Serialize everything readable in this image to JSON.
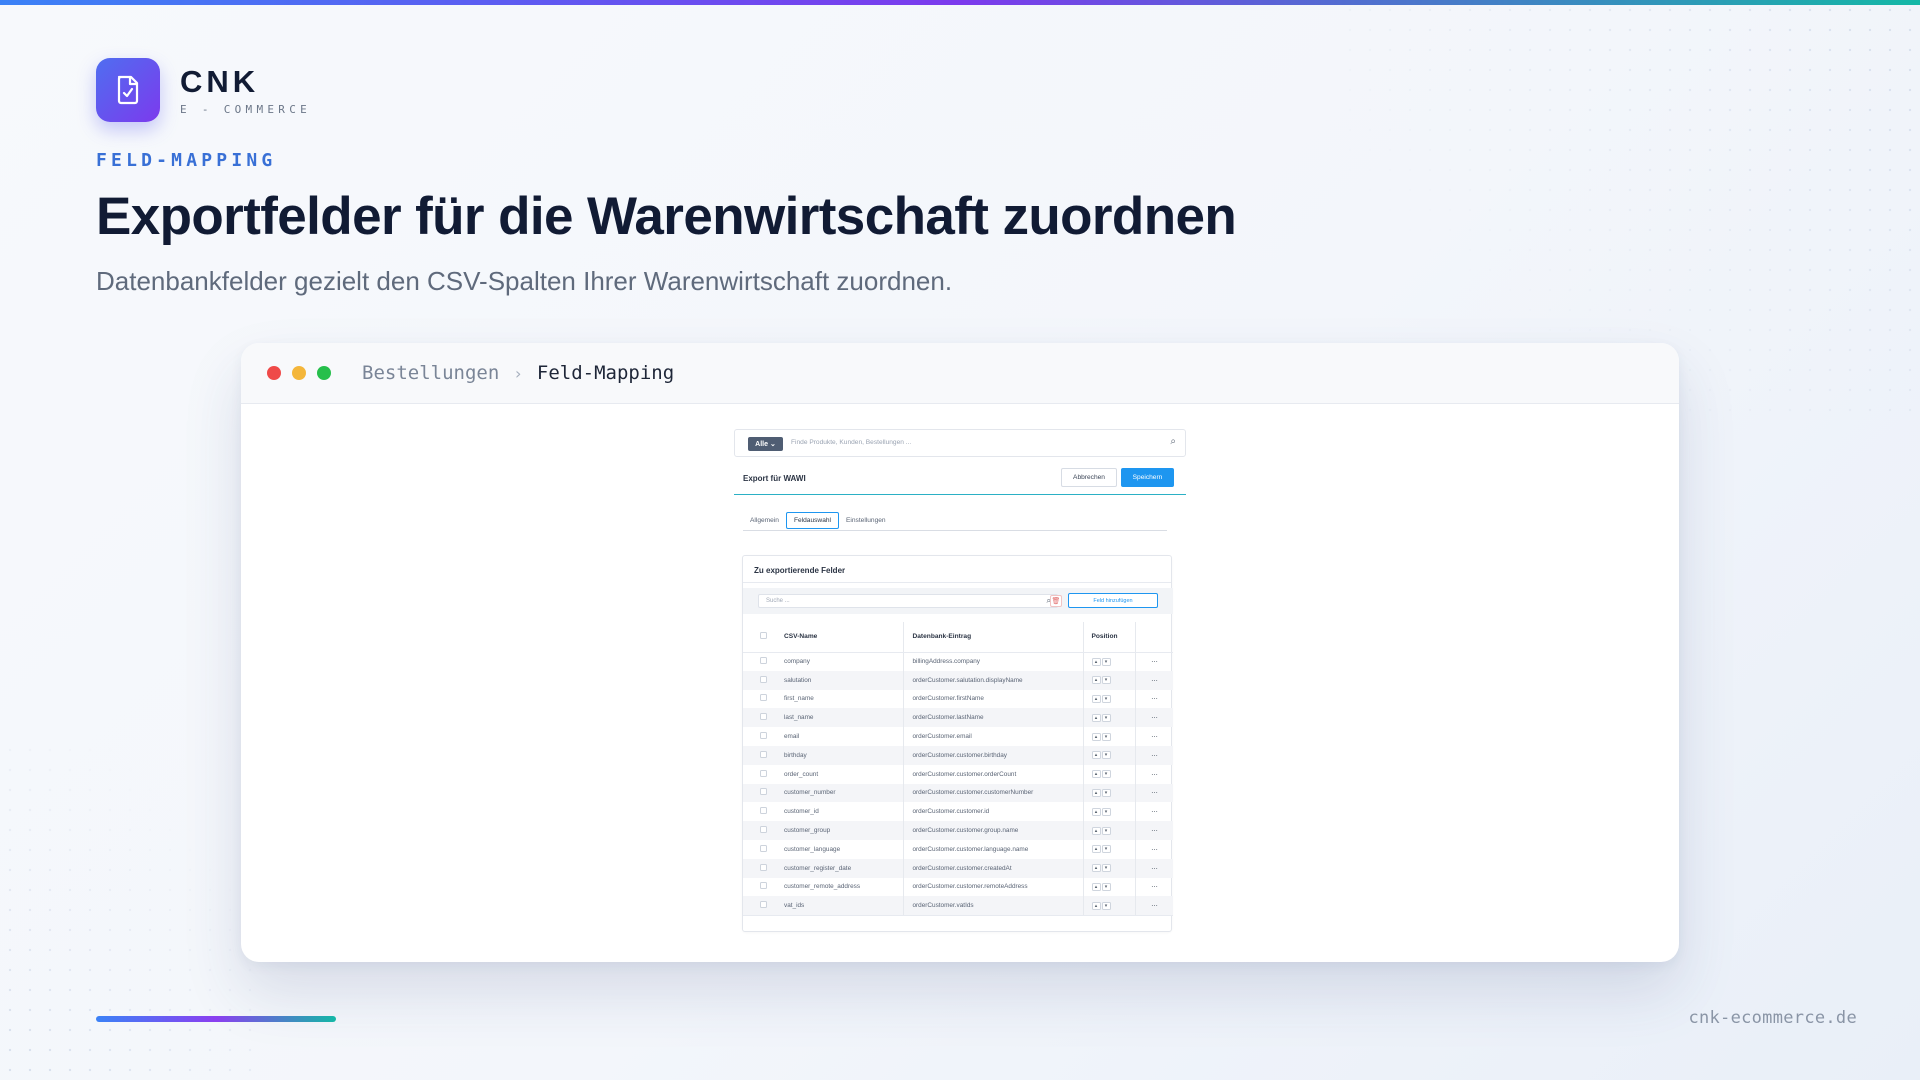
{
  "brand": {
    "name": "CNK",
    "tagline": "E - COMMERCE",
    "icon": "document-check-icon"
  },
  "hero": {
    "eyebrow": "FELD-MAPPING",
    "title": "Exportfelder für die Warenwirtschaft zuordnen",
    "subtitle": "Datenbankfelder gezielt den CSV-Spalten Ihrer Warenwirtschaft zuordnen."
  },
  "window": {
    "breadcrumb": {
      "parent": "Bestellungen",
      "separator": "›",
      "current": "Feld-Mapping"
    }
  },
  "app": {
    "search": {
      "scope": "Alle",
      "placeholder": "Finde Produkte, Kunden, Bestellungen ..."
    },
    "title": "Export für WAWI",
    "cancel_label": "Abbrechen",
    "save_label": "Speichern",
    "tabs": [
      "Allgemein",
      "Feldauswahl",
      "Einstellungen"
    ],
    "active_tab": "Feldauswahl",
    "card": {
      "title": "Zu exportierende Felder",
      "search_placeholder": "Suche ...",
      "add_label": "Feld hinzufügen",
      "columns": {
        "csv": "CSV-Name",
        "db": "Datenbank-Eintrag",
        "position": "Position"
      },
      "rows": [
        {
          "csv": "company",
          "db": "billingAddress.company"
        },
        {
          "csv": "salutation",
          "db": "orderCustomer.salutation.displayName"
        },
        {
          "csv": "first_name",
          "db": "orderCustomer.firstName"
        },
        {
          "csv": "last_name",
          "db": "orderCustomer.lastName"
        },
        {
          "csv": "email",
          "db": "orderCustomer.email"
        },
        {
          "csv": "birthday",
          "db": "orderCustomer.customer.birthday"
        },
        {
          "csv": "order_count",
          "db": "orderCustomer.customer.orderCount"
        },
        {
          "csv": "customer_number",
          "db": "orderCustomer.customer.customerNumber"
        },
        {
          "csv": "customer_id",
          "db": "orderCustomer.customer.id"
        },
        {
          "csv": "customer_group",
          "db": "orderCustomer.customer.group.name"
        },
        {
          "csv": "customer_language",
          "db": "orderCustomer.customer.language.name"
        },
        {
          "csv": "customer_register_date",
          "db": "orderCustomer.customer.createdAt"
        },
        {
          "csv": "customer_remote_address",
          "db": "orderCustomer.customer.remoteAddress"
        },
        {
          "csv": "vat_ids",
          "db": "orderCustomer.vatIds"
        }
      ]
    }
  },
  "footer": {
    "site": "cnk-ecommerce.de"
  },
  "colors": {
    "accent": "#3970d6",
    "primary_button": "#1e96f0",
    "headline": "#111b34"
  }
}
